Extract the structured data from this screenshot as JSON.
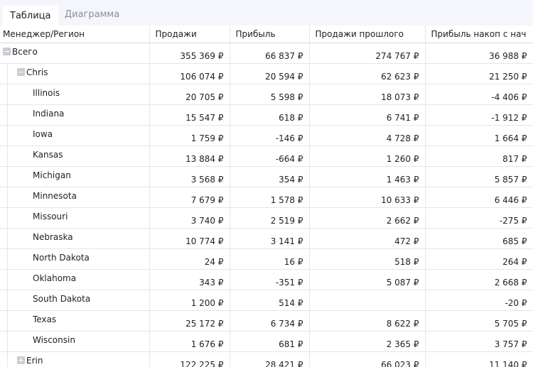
{
  "tabs": [
    {
      "label": "Таблица",
      "active": true
    },
    {
      "label": "Диаграмма",
      "active": false
    }
  ],
  "columns": [
    "Менеджер/Регион",
    "Продажи",
    "Прибыль",
    "Продажи прошлого",
    "Прибыль накоп с нач"
  ],
  "rows": [
    {
      "name": "Всего",
      "level": 0,
      "toggle": "collapse",
      "values": [
        "355 369 ₽",
        "66 837 ₽",
        "274 767 ₽",
        "36 988 ₽"
      ]
    },
    {
      "name": "Chris",
      "level": 1,
      "toggle": "collapse",
      "values": [
        "106 074 ₽",
        "20 594 ₽",
        "62 623 ₽",
        "21 250 ₽"
      ]
    },
    {
      "name": "Illinois",
      "level": 2,
      "toggle": "",
      "values": [
        "20 705 ₽",
        "5 598 ₽",
        "18 073 ₽",
        "-4 406 ₽"
      ]
    },
    {
      "name": "Indiana",
      "level": 2,
      "toggle": "",
      "values": [
        "15 547 ₽",
        "618 ₽",
        "6 741 ₽",
        "-1 912 ₽"
      ]
    },
    {
      "name": "Iowa",
      "level": 2,
      "toggle": "",
      "values": [
        "1 759 ₽",
        "-146 ₽",
        "4 728 ₽",
        "1 664 ₽"
      ]
    },
    {
      "name": "Kansas",
      "level": 2,
      "toggle": "",
      "values": [
        "13 884 ₽",
        "-664 ₽",
        "1 260 ₽",
        "817 ₽"
      ]
    },
    {
      "name": "Michigan",
      "level": 2,
      "toggle": "",
      "values": [
        "3 568 ₽",
        "354 ₽",
        "1 463 ₽",
        "5 857 ₽"
      ]
    },
    {
      "name": "Minnesota",
      "level": 2,
      "toggle": "",
      "values": [
        "7 679 ₽",
        "1 578 ₽",
        "10 633 ₽",
        "6 446 ₽"
      ]
    },
    {
      "name": "Missouri",
      "level": 2,
      "toggle": "",
      "values": [
        "3 740 ₽",
        "2 519 ₽",
        "2 662 ₽",
        "-275 ₽"
      ]
    },
    {
      "name": "Nebraska",
      "level": 2,
      "toggle": "",
      "values": [
        "10 774 ₽",
        "3 141 ₽",
        "472 ₽",
        "685 ₽"
      ]
    },
    {
      "name": "North Dakota",
      "level": 2,
      "toggle": "",
      "values": [
        "24 ₽",
        "16 ₽",
        "518 ₽",
        "264 ₽"
      ]
    },
    {
      "name": "Oklahoma",
      "level": 2,
      "toggle": "",
      "values": [
        "343 ₽",
        "-351 ₽",
        "5 087 ₽",
        "2 668 ₽"
      ]
    },
    {
      "name": "South Dakota",
      "level": 2,
      "toggle": "",
      "values": [
        "1 200 ₽",
        "514 ₽",
        "",
        "-20 ₽"
      ]
    },
    {
      "name": "Texas",
      "level": 2,
      "toggle": "",
      "values": [
        "25 172 ₽",
        "6 734 ₽",
        "8 622 ₽",
        "5 705 ₽"
      ]
    },
    {
      "name": "Wisconsin",
      "level": 2,
      "toggle": "",
      "values": [
        "1 676 ₽",
        "681 ₽",
        "2 365 ₽",
        "3 757 ₽"
      ]
    },
    {
      "name": "Erin",
      "level": 1,
      "toggle": "expand",
      "values": [
        "122 225 ₽",
        "28 421 ₽",
        "66 023 ₽",
        "11 140 ₽"
      ]
    }
  ]
}
